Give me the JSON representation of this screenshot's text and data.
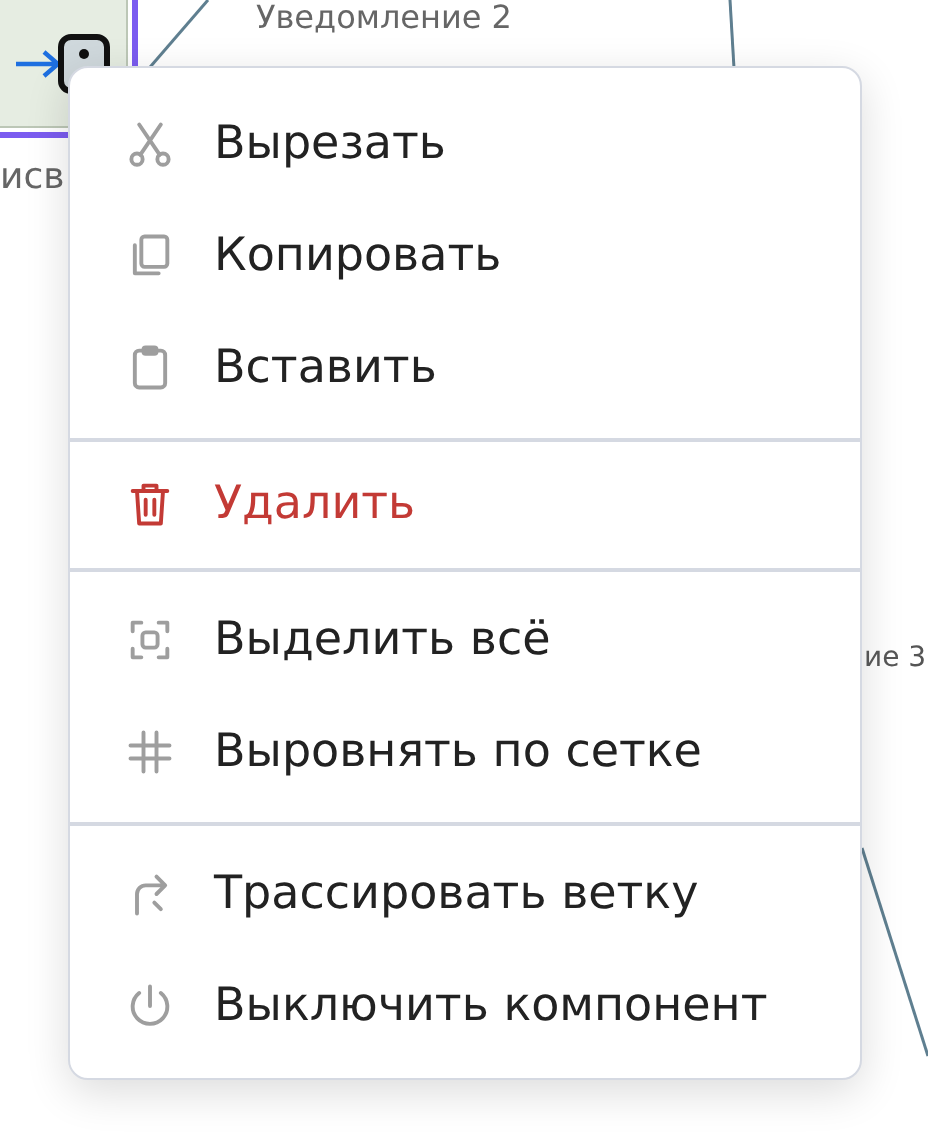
{
  "canvas": {
    "labels": [
      {
        "text": "Уведомление 2",
        "kind": "top"
      },
      {
        "text": "исв",
        "kind": "left"
      },
      {
        "text": "ие 3",
        "kind": "right"
      }
    ]
  },
  "context_menu": {
    "groups": [
      {
        "items": [
          {
            "label": "Вырезать",
            "kind": "normal"
          },
          {
            "label": "Копировать",
            "kind": "normal"
          },
          {
            "label": "Вставить",
            "kind": "normal"
          }
        ]
      },
      {
        "items": [
          {
            "label": "Удалить",
            "kind": "danger"
          }
        ]
      },
      {
        "items": [
          {
            "label": "Выделить всё",
            "kind": "normal"
          },
          {
            "label": "Выровнять по сетке",
            "kind": "normal"
          }
        ]
      },
      {
        "items": [
          {
            "label": "Трассировать ветку",
            "kind": "normal"
          },
          {
            "label": "Выключить компонент",
            "kind": "normal"
          }
        ]
      }
    ]
  }
}
